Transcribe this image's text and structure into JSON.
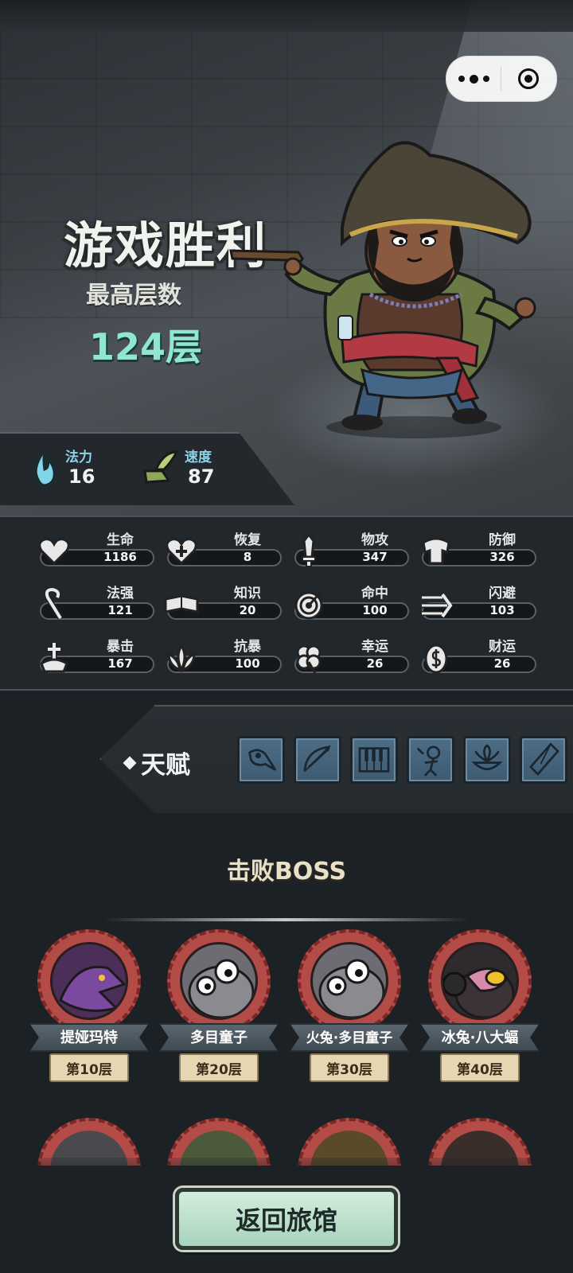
{
  "result": {
    "title": "游戏胜利",
    "subtitle": "最高层数",
    "floors": "124层"
  },
  "mini_stats": [
    {
      "label": "法力",
      "value": "16",
      "icon": "blue-flame-icon"
    },
    {
      "label": "速度",
      "value": "87",
      "icon": "winged-boot-icon"
    }
  ],
  "stats": [
    {
      "label": "生命",
      "value": "1186",
      "icon": "heart-icon"
    },
    {
      "label": "恢复",
      "value": "8",
      "icon": "heart-plus-icon"
    },
    {
      "label": "物攻",
      "value": "347",
      "icon": "sword-icon"
    },
    {
      "label": "防御",
      "value": "326",
      "icon": "armor-icon"
    },
    {
      "label": "法强",
      "value": "121",
      "icon": "staff-icon"
    },
    {
      "label": "知识",
      "value": "20",
      "icon": "book-icon"
    },
    {
      "label": "命中",
      "value": "100",
      "icon": "target-icon"
    },
    {
      "label": "闪避",
      "value": "103",
      "icon": "dodge-arrows-icon"
    },
    {
      "label": "暴击",
      "value": "167",
      "icon": "crit-dagger-icon"
    },
    {
      "label": "抗暴",
      "value": "100",
      "icon": "shield-lotus-icon"
    },
    {
      "label": "幸运",
      "value": "26",
      "icon": "clover-icon"
    },
    {
      "label": "财运",
      "value": "26",
      "icon": "coin-icon"
    }
  ],
  "talent": {
    "label": "天赋",
    "icons": [
      "plague-mask-icon",
      "bow-icon",
      "piano-keys-icon",
      "skeleton-icon",
      "herb-bowl-icon",
      "crystal-icon"
    ]
  },
  "bosses_title": "击败BOSS",
  "bosses": [
    {
      "name": "提娅玛特",
      "floor": "第10层"
    },
    {
      "name": "多目童子",
      "floor": "第20层"
    },
    {
      "name": "火兔·多目童子",
      "floor": "第30层"
    },
    {
      "name": "冰兔·八大蝠",
      "floor": "第40层"
    }
  ],
  "return_button": "返回旅馆",
  "colors": {
    "accent_teal": "#8fe6d2",
    "boss_ring": "#b34b47",
    "button_green": "#bfe2cd"
  }
}
